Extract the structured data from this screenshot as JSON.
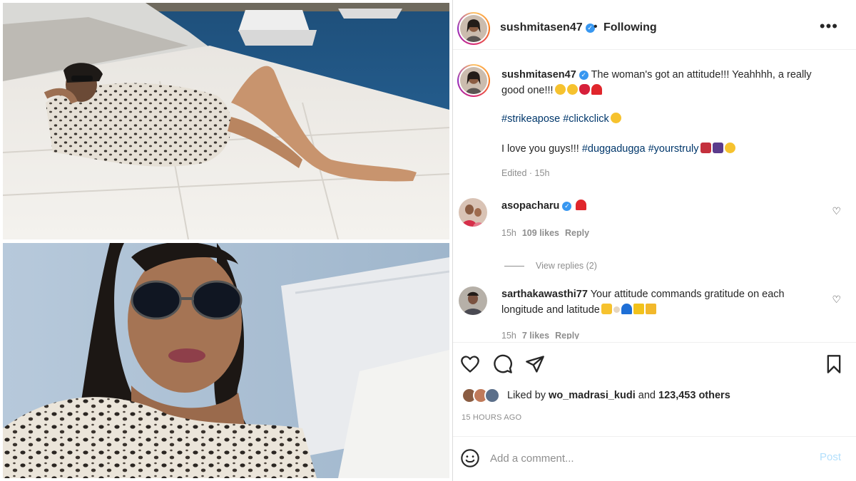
{
  "post": {
    "username": "sushmitasen47",
    "separator": "•",
    "follow_status": "Following",
    "more_label": "•••",
    "caption": {
      "line1_text": "The woman's got an attitude!!! Yeahhhh, a really good one!!!",
      "hashtags_line": "#strikeapose #clickclick",
      "line3_text": "I love you guys!!!",
      "line3_hashtags": "#duggadugga #yourstruly",
      "time": "Edited · 15h"
    },
    "comments": [
      {
        "username": "asopacharu",
        "text": "",
        "time": "15h",
        "likes": "109 likes",
        "reply": "Reply",
        "view_replies": "View replies (2)"
      },
      {
        "username": "sarthakawasthi77",
        "text": "Your attitude commands gratitude on each longitude and latitude",
        "time": "15h",
        "likes": "7 likes",
        "reply": "Reply"
      }
    ],
    "liked_by_prefix": "Liked by",
    "liked_by_user": "wo_madrasi_kudi",
    "liked_by_and": "and",
    "liked_by_others": "123,453 others",
    "timestamp": "15 HOURS AGO",
    "comment_placeholder": "Add a comment...",
    "post_button": "Post"
  },
  "icons": {
    "heart": "heart-icon",
    "comment": "comment-icon",
    "share": "share-icon",
    "bookmark": "bookmark-icon",
    "emoji": "smile-icon"
  },
  "colors": {
    "verified": "#3897f0",
    "link": "#00376b",
    "muted": "#8e8e8e",
    "post_button": "#b2dffc"
  }
}
